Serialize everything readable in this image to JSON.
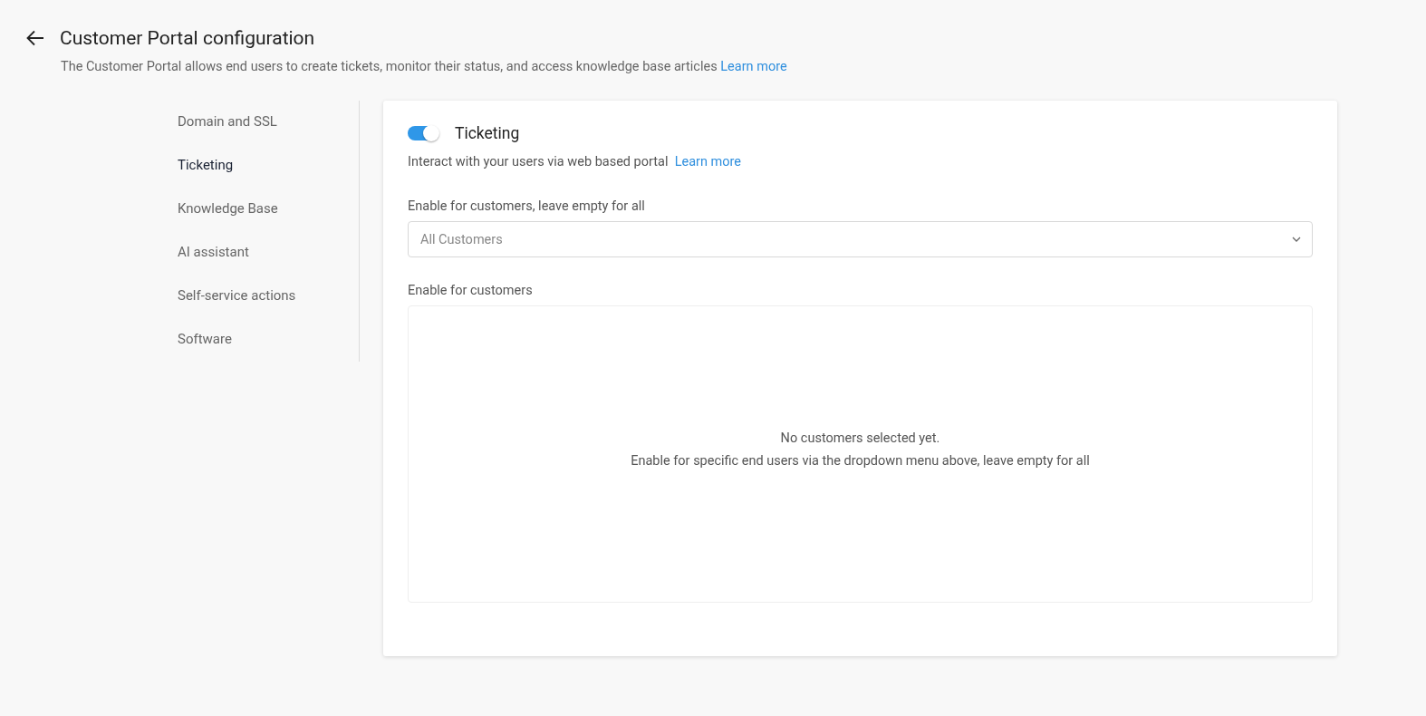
{
  "header": {
    "title": "Customer Portal configuration",
    "description": "The Customer Portal allows end users to create tickets, monitor their status, and access knowledge base articles",
    "link": "Learn more"
  },
  "sidebar": {
    "items": [
      {
        "label": "Domain and SSL",
        "selected": false
      },
      {
        "label": "Ticketing",
        "selected": true
      },
      {
        "label": "Knowledge Base",
        "selected": false
      },
      {
        "label": "AI assistant",
        "selected": false
      },
      {
        "label": "Self-service actions",
        "selected": false
      },
      {
        "label": "Software",
        "selected": false
      }
    ]
  },
  "panel": {
    "title": "Ticketing",
    "enabled": true,
    "description": "Interact with your users via web based portal",
    "link": "Learn more",
    "select_label": "Enable for customers, leave empty for all",
    "select": {
      "placeholder": "All Customers"
    },
    "list_label": "Enable for customers",
    "empty_title": "No customers selected yet.",
    "empty_hint": "Enable for specific end users via the dropdown menu above, leave empty for all"
  }
}
